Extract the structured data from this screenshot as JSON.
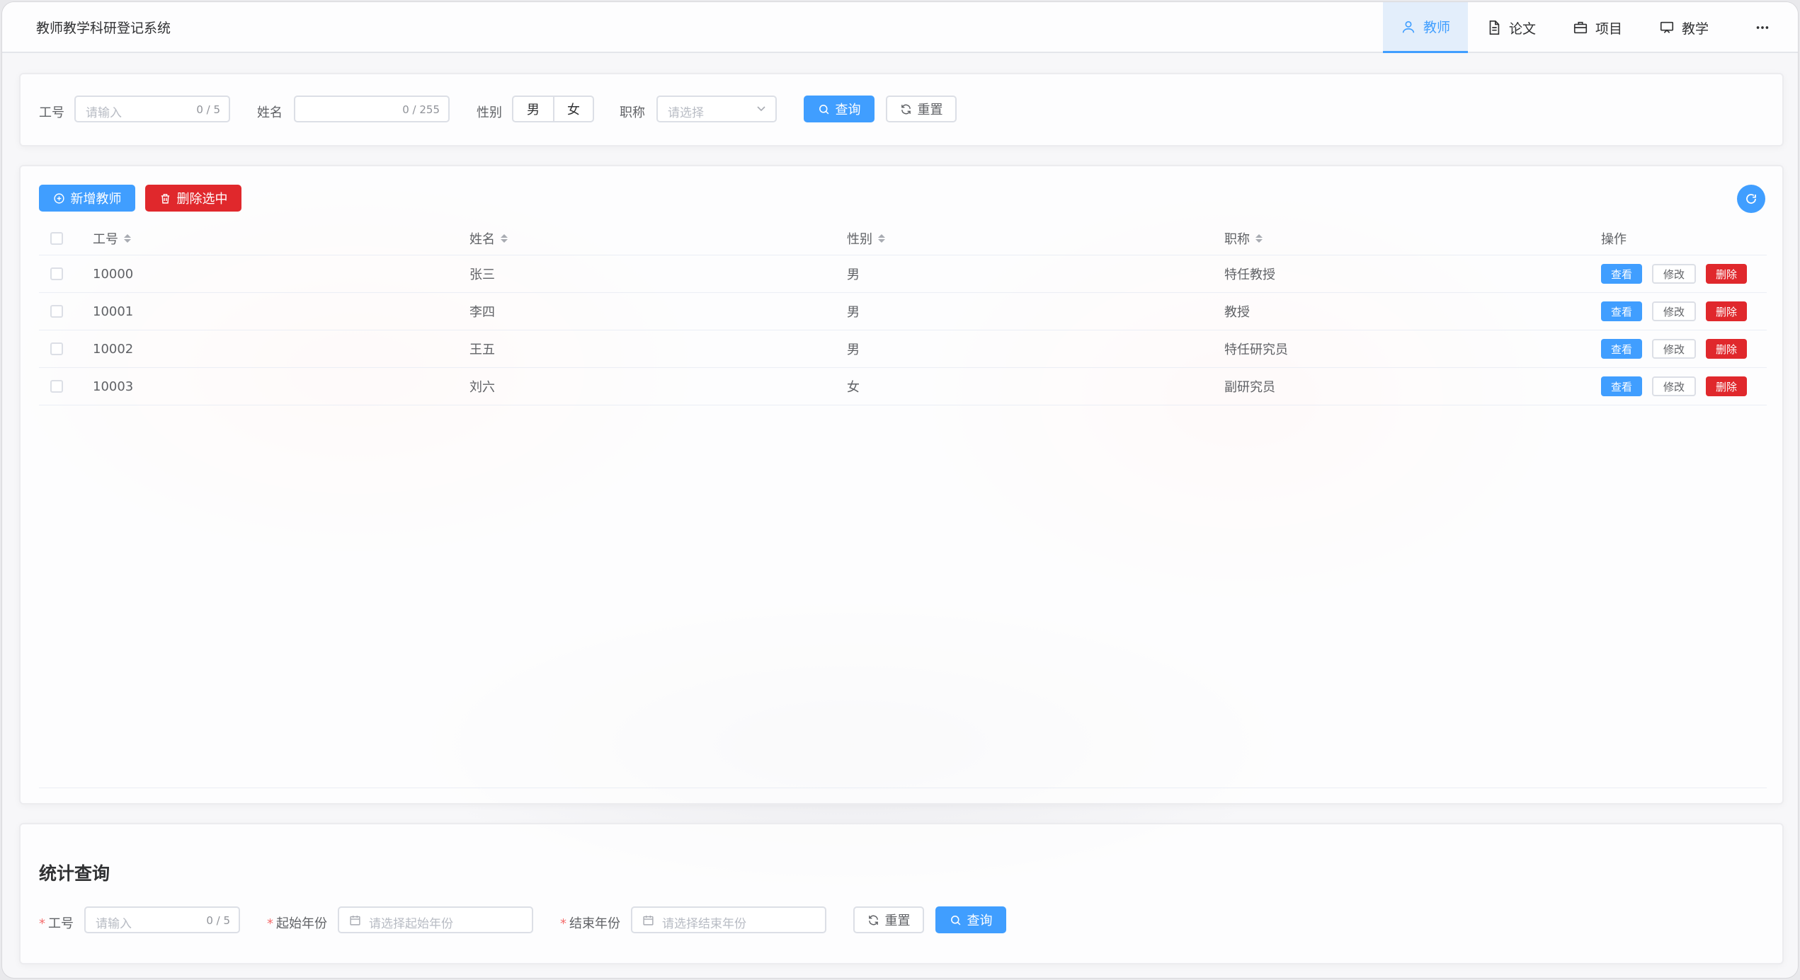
{
  "app": {
    "title": "教师教学科研登记系统"
  },
  "nav": {
    "items": [
      {
        "label": "教师",
        "icon": "user-icon",
        "active": true
      },
      {
        "label": "论文",
        "icon": "document-icon",
        "active": false
      },
      {
        "label": "项目",
        "icon": "briefcase-icon",
        "active": false
      },
      {
        "label": "教学",
        "icon": "presentation-icon",
        "active": false
      }
    ],
    "more_icon": "more-dots-icon"
  },
  "search": {
    "id_label": "工号",
    "id_placeholder": "请输入",
    "id_count": "0 / 5",
    "name_label": "姓名",
    "name_count": "0 / 255",
    "gender_label": "性别",
    "gender_options": [
      "男",
      "女"
    ],
    "title_label": "职称",
    "title_placeholder": "请选择",
    "query_label": "查询",
    "reset_label": "重置"
  },
  "toolbar": {
    "add_label": "新增教师",
    "delete_selected_label": "删除选中"
  },
  "table": {
    "columns": [
      "工号",
      "姓名",
      "性别",
      "职称",
      "操作"
    ],
    "rows": [
      {
        "id": "10000",
        "name": "张三",
        "gender": "男",
        "title": "特任教授"
      },
      {
        "id": "10001",
        "name": "李四",
        "gender": "男",
        "title": "教授"
      },
      {
        "id": "10002",
        "name": "王五",
        "gender": "男",
        "title": "特任研究员"
      },
      {
        "id": "10003",
        "name": "刘六",
        "gender": "女",
        "title": "副研究员"
      }
    ],
    "actions": {
      "view": "查看",
      "edit": "修改",
      "delete": "删除"
    }
  },
  "stats": {
    "title": "统计查询",
    "id_label": "工号",
    "id_placeholder": "请输入",
    "id_count": "0 / 5",
    "start_label": "起始年份",
    "start_placeholder": "请选择起始年份",
    "end_label": "结束年份",
    "end_placeholder": "请选择结束年份",
    "reset_label": "重置",
    "query_label": "查询",
    "required_mark": "*"
  },
  "colors": {
    "primary": "#409eff",
    "danger": "#e0282c"
  }
}
